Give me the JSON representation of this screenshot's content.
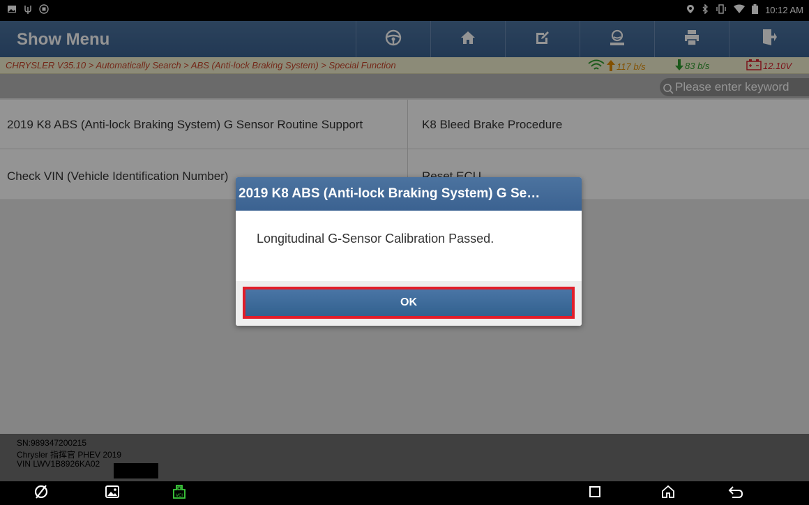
{
  "status_bar": {
    "time": "10:12 AM",
    "left_icons": [
      "image-icon",
      "usb-icon",
      "android-debug-icon"
    ],
    "right_icons": [
      "location-icon",
      "bluetooth-icon",
      "vibrate-icon",
      "wifi-icon",
      "battery-icon"
    ]
  },
  "header": {
    "title": "Show Menu",
    "buttons": [
      {
        "name": "steering-wheel-icon"
      },
      {
        "name": "home-icon"
      },
      {
        "name": "edit-icon"
      },
      {
        "name": "user-icon"
      },
      {
        "name": "print-icon"
      },
      {
        "name": "exit-icon"
      }
    ]
  },
  "breadcrumb": {
    "path": "CHRYSLER V35.10 > Automatically Search > ABS (Anti-lock Braking System) > Special Function",
    "upload": "117 b/s",
    "download": "83 b/s",
    "voltage": "12.10V",
    "upload_color": "#e08a00",
    "download_color": "#2e9a2e",
    "voltage_color": "#d6222e"
  },
  "search": {
    "placeholder": "Please enter keyword"
  },
  "functions": {
    "item1": "2019 K8 ABS (Anti-lock Braking System) G Sensor Routine Support",
    "item2": "K8 Bleed Brake Procedure",
    "item3": "Check VIN (Vehicle Identification Number)",
    "item4": "Reset ECU"
  },
  "dialog": {
    "title": "2019 K8 ABS (Anti-lock Braking System) G Se…",
    "message": "Longitudinal G-Sensor Calibration Passed.",
    "ok_label": "OK",
    "highlight_color": "#e11d2a"
  },
  "footer": {
    "sn": "SN:989347200215",
    "vehicle": "Chrysler 指挥官 PHEV 2019",
    "vin": "VIN LWV1B8926KA02"
  },
  "nav_bar": {
    "buttons": [
      "browser-icon",
      "gallery-icon",
      "vci-icon",
      "recent-apps-icon",
      "home-nav-icon",
      "back-icon"
    ]
  }
}
